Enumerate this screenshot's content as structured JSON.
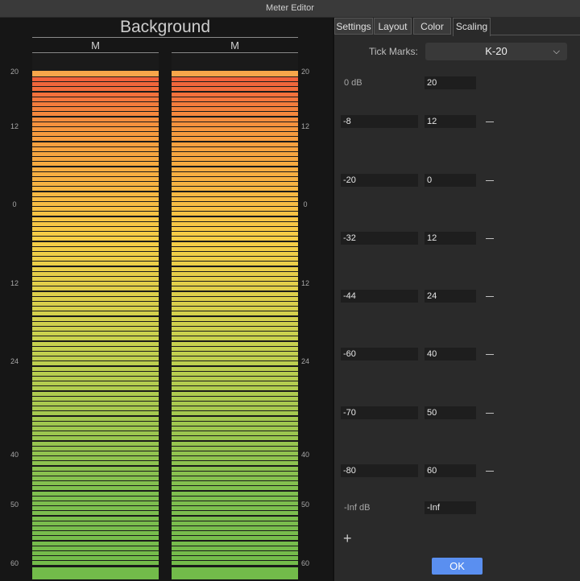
{
  "window": {
    "title": "Meter Editor"
  },
  "meter": {
    "title": "Background",
    "channels": [
      "M",
      "M"
    ],
    "scale_labels": [
      "20",
      "12",
      "0",
      "12",
      "24",
      "40",
      "50",
      "60"
    ],
    "segment_colors": {
      "top": "#f7a64a",
      "red": "#f05a3a",
      "orange": "#f79a3e",
      "yellow": "#f7cd46",
      "lime": "#c6d14f",
      "green": "#7fbf4f",
      "bottom": "#72bb4a"
    }
  },
  "tabs": [
    {
      "label": "Settings",
      "active": false
    },
    {
      "label": "Layout",
      "active": false
    },
    {
      "label": "Color",
      "active": false
    },
    {
      "label": "Scaling",
      "active": true
    }
  ],
  "scaling": {
    "tick_marks_label": "Tick Marks:",
    "tick_marks_value": "K-20",
    "zero_db_label": "0 dB",
    "zero_db_value": "20",
    "rows": [
      {
        "db": "-8",
        "label": "12"
      },
      {
        "db": "-20",
        "label": "0"
      },
      {
        "db": "-32",
        "label": "12"
      },
      {
        "db": "-44",
        "label": "24"
      },
      {
        "db": "-60",
        "label": "40"
      },
      {
        "db": "-70",
        "label": "50"
      },
      {
        "db": "-80",
        "label": "60"
      }
    ],
    "inf_label": "-Inf dB",
    "inf_value": "-Inf",
    "add_symbol": "+",
    "ok_label": "OK"
  },
  "colors": {
    "accent": "#5a8ff0",
    "panel": "#2a2a2a",
    "field": "#1e1e1e"
  }
}
